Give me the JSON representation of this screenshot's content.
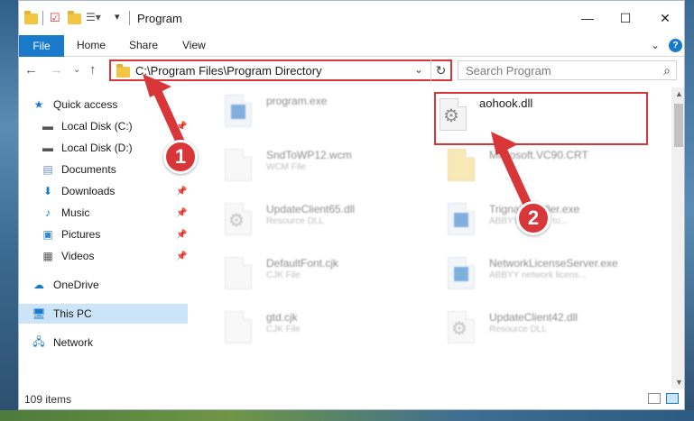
{
  "window": {
    "title": "Program",
    "minimize_icon": "minimize-icon",
    "maximize_icon": "maximize-icon",
    "close_icon": "close-icon"
  },
  "ribbon": {
    "file": "File",
    "home": "Home",
    "share": "Share",
    "view": "View"
  },
  "address": {
    "path": "C:\\Program Files\\Program Directory",
    "search_placeholder": "Search Program"
  },
  "sidebar": {
    "items": [
      {
        "label": "Quick access",
        "icon": "star-icon"
      },
      {
        "label": "Local Disk (C:)",
        "icon": "drive-icon"
      },
      {
        "label": "Local Disk (D:)",
        "icon": "drive-icon"
      },
      {
        "label": "Documents",
        "icon": "documents-icon"
      },
      {
        "label": "Downloads",
        "icon": "download-icon"
      },
      {
        "label": "Music",
        "icon": "music-icon"
      },
      {
        "label": "Pictures",
        "icon": "pictures-icon"
      },
      {
        "label": "Videos",
        "icon": "videos-icon"
      },
      {
        "label": "OneDrive",
        "icon": "cloud-icon"
      },
      {
        "label": "This PC",
        "icon": "computer-icon"
      },
      {
        "label": "Network",
        "icon": "network-icon"
      }
    ]
  },
  "files": [
    {
      "name": "program.exe",
      "type": ""
    },
    {
      "name": "aohook.dll",
      "type": ""
    },
    {
      "name": "SndToWP12.wcm",
      "type": "WCM File"
    },
    {
      "name": "Microsoft.VC90.CRT",
      "type": ""
    },
    {
      "name": "UpdateClient65.dll",
      "type": "Resource DLL"
    },
    {
      "name": "TrignalInstaller.exe",
      "type": "ABBYY Vendor to..."
    },
    {
      "name": "DefaultFont.cjk",
      "type": "CJK File"
    },
    {
      "name": "NetworkLicenseServer.exe",
      "type": "ABBYY network licens..."
    },
    {
      "name": "gtd.cjk",
      "type": "CJK File"
    },
    {
      "name": "UpdateClient42.dll",
      "type": "Resource DLL"
    }
  ],
  "callouts": {
    "one": "1",
    "two": "2"
  },
  "status": {
    "items_count": "109 items"
  },
  "colors": {
    "accent": "#1979ca",
    "highlight": "#d9363a",
    "selection": "#cce4f7"
  }
}
